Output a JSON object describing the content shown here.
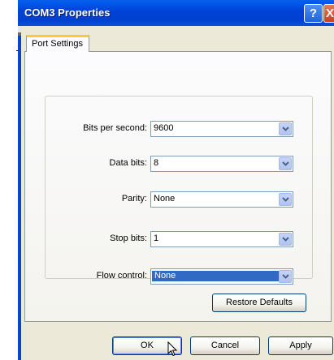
{
  "window": {
    "title": "COM3 Properties",
    "help_glyph": "?",
    "close_glyph": "X"
  },
  "tabs": [
    {
      "label": "Port Settings",
      "active": true
    }
  ],
  "settings": [
    {
      "label": "Bits per second:",
      "value": "9600"
    },
    {
      "label": "Data bits:",
      "value": "8"
    },
    {
      "label": "Parity:",
      "value": "None"
    },
    {
      "label": "Stop bits:",
      "value": "1"
    },
    {
      "label": "Flow control:",
      "value": "None",
      "focused": true
    }
  ],
  "buttons": {
    "restore_defaults": "Restore Defaults",
    "ok": "OK",
    "cancel": "Cancel",
    "apply": "Apply"
  },
  "icons": {
    "help": "question-mark-icon",
    "close": "close-icon",
    "dropdown": "chevron-down-icon",
    "cursor": "mouse-pointer-icon"
  },
  "colors": {
    "titlebar": "#0043d6",
    "selection": "#316ac5",
    "tab_highlight": "#ffc83c",
    "dialog_face": "#ece9d8"
  }
}
